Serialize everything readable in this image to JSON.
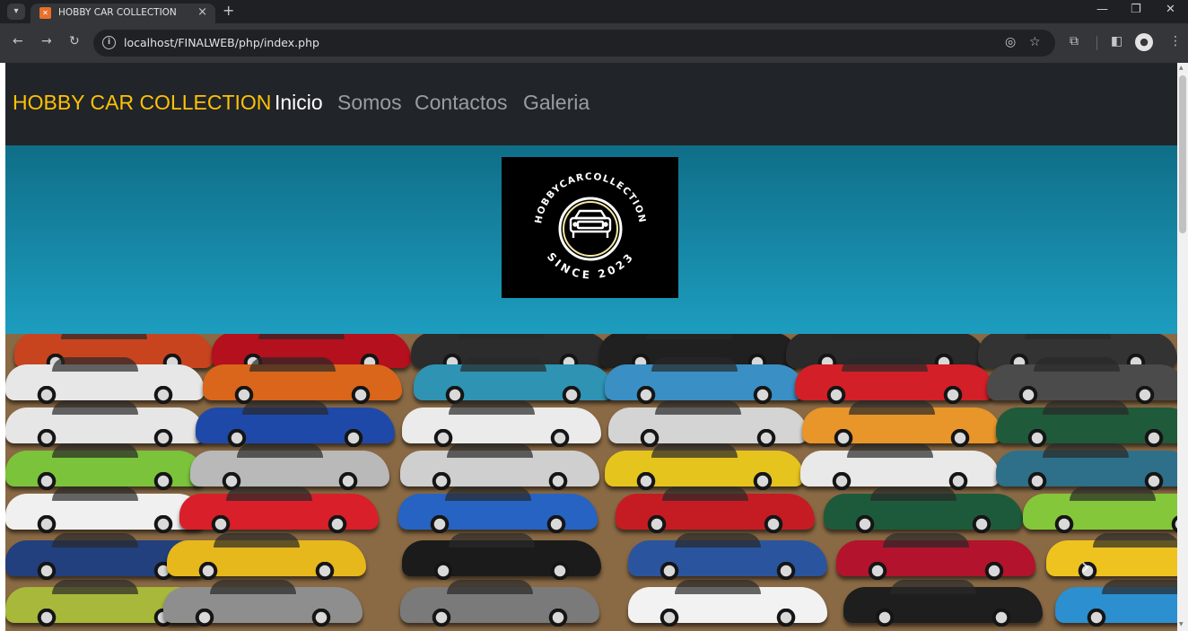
{
  "browser": {
    "tab_title": "HOBBY CAR COLLECTION",
    "url": "localhost/FINALWEB/php/index.php"
  },
  "nav": {
    "brand": "HOBBY CAR COLLECTION",
    "links": [
      "Inicio",
      "Somos",
      "Contactos",
      "Galeria"
    ],
    "active_link": "Inicio"
  },
  "logo": {
    "text_top": "HOBBYCARCOLLECTION",
    "text_bottom": "SINCE 2023"
  },
  "colors": {
    "brand": "#ffc107",
    "nav_bg": "#212529",
    "hero_gradient": [
      "#0f6e88",
      "#1d9dbf"
    ]
  },
  "carousel": {
    "next_icon": "chevron-right-icon"
  }
}
